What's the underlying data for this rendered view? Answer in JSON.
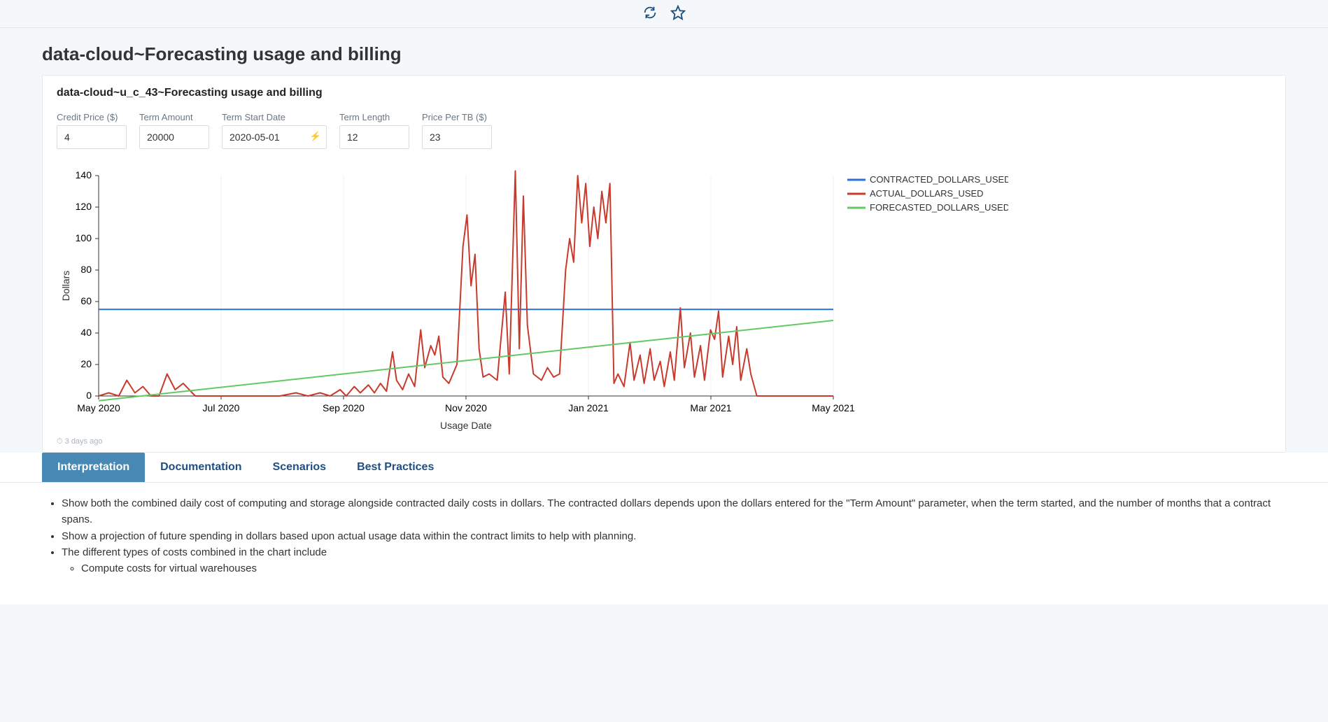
{
  "header": {
    "refresh_icon": "refresh",
    "star_icon": "star"
  },
  "page_title": "data-cloud~Forecasting usage and billing",
  "sub_title": "data-cloud~u_c_43~Forecasting usage and billing",
  "params": {
    "credit_price": {
      "label": "Credit Price ($)",
      "value": "4"
    },
    "term_amount": {
      "label": "Term Amount",
      "value": "20000"
    },
    "term_start_date": {
      "label": "Term Start Date",
      "value": "2020-05-01"
    },
    "term_length": {
      "label": "Term Length",
      "value": "12"
    },
    "price_per_tb": {
      "label": "Price Per TB ($)",
      "value": "23"
    }
  },
  "meta_text": "3 days ago",
  "tabs": {
    "items": [
      "Interpretation",
      "Documentation",
      "Scenarios",
      "Best Practices"
    ],
    "active_index": 0
  },
  "interpretation": {
    "bullets": [
      "Show both the combined daily cost of computing and storage alongside contracted daily costs in dollars. The contracted dollars depends upon the dollars entered for the \"Term Amount\" parameter, when the term started, and the number of months that a contract spans.",
      "Show a projection of future spending in dollars based upon actual usage data within the contract limits to help with planning.",
      "The different types of costs combined in the chart include"
    ],
    "sub_bullets": [
      "Compute costs for virtual warehouses"
    ]
  },
  "chart_data": {
    "type": "line",
    "title": "",
    "xlabel": "Usage Date",
    "ylabel": "Dollars",
    "ylim": [
      0,
      140
    ],
    "y_ticks": [
      0,
      20,
      40,
      60,
      80,
      100,
      120,
      140
    ],
    "x_tick_labels": [
      "May 2020",
      "Jul 2020",
      "Sep 2020",
      "Nov 2020",
      "Jan 2021",
      "Mar 2021",
      "May 2021"
    ],
    "x_range_days": [
      0,
      365
    ],
    "series": [
      {
        "name": "CONTRACTED_DOLLARS_USED",
        "color": "#2b6fd7",
        "type": "constant",
        "value": 55,
        "x_start": 0,
        "x_end": 365
      },
      {
        "name": "ACTUAL_DOLLARS_USED",
        "color": "#c83a2c",
        "type": "line",
        "data": [
          {
            "d": 0,
            "v": 0
          },
          {
            "d": 5,
            "v": 2
          },
          {
            "d": 10,
            "v": 0
          },
          {
            "d": 14,
            "v": 10
          },
          {
            "d": 18,
            "v": 2
          },
          {
            "d": 22,
            "v": 6
          },
          {
            "d": 26,
            "v": 0
          },
          {
            "d": 30,
            "v": 0
          },
          {
            "d": 34,
            "v": 14
          },
          {
            "d": 38,
            "v": 4
          },
          {
            "d": 42,
            "v": 8
          },
          {
            "d": 48,
            "v": 0
          },
          {
            "d": 60,
            "v": 0
          },
          {
            "d": 75,
            "v": 0
          },
          {
            "d": 90,
            "v": 0
          },
          {
            "d": 98,
            "v": 2
          },
          {
            "d": 104,
            "v": 0
          },
          {
            "d": 110,
            "v": 2
          },
          {
            "d": 115,
            "v": 0
          },
          {
            "d": 120,
            "v": 4
          },
          {
            "d": 123,
            "v": 0
          },
          {
            "d": 127,
            "v": 6
          },
          {
            "d": 130,
            "v": 2
          },
          {
            "d": 134,
            "v": 7
          },
          {
            "d": 137,
            "v": 2
          },
          {
            "d": 140,
            "v": 8
          },
          {
            "d": 143,
            "v": 3
          },
          {
            "d": 146,
            "v": 28
          },
          {
            "d": 148,
            "v": 10
          },
          {
            "d": 151,
            "v": 4
          },
          {
            "d": 154,
            "v": 14
          },
          {
            "d": 157,
            "v": 6
          },
          {
            "d": 160,
            "v": 42
          },
          {
            "d": 162,
            "v": 18
          },
          {
            "d": 165,
            "v": 32
          },
          {
            "d": 167,
            "v": 26
          },
          {
            "d": 169,
            "v": 38
          },
          {
            "d": 171,
            "v": 12
          },
          {
            "d": 174,
            "v": 8
          },
          {
            "d": 178,
            "v": 20
          },
          {
            "d": 181,
            "v": 95
          },
          {
            "d": 183,
            "v": 115
          },
          {
            "d": 185,
            "v": 70
          },
          {
            "d": 187,
            "v": 90
          },
          {
            "d": 189,
            "v": 30
          },
          {
            "d": 191,
            "v": 12
          },
          {
            "d": 194,
            "v": 14
          },
          {
            "d": 198,
            "v": 10
          },
          {
            "d": 202,
            "v": 66
          },
          {
            "d": 204,
            "v": 14
          },
          {
            "d": 207,
            "v": 143
          },
          {
            "d": 209,
            "v": 30
          },
          {
            "d": 211,
            "v": 127
          },
          {
            "d": 213,
            "v": 45
          },
          {
            "d": 216,
            "v": 14
          },
          {
            "d": 220,
            "v": 10
          },
          {
            "d": 223,
            "v": 18
          },
          {
            "d": 226,
            "v": 12
          },
          {
            "d": 229,
            "v": 14
          },
          {
            "d": 232,
            "v": 80
          },
          {
            "d": 234,
            "v": 100
          },
          {
            "d": 236,
            "v": 85
          },
          {
            "d": 238,
            "v": 140
          },
          {
            "d": 240,
            "v": 110
          },
          {
            "d": 242,
            "v": 135
          },
          {
            "d": 244,
            "v": 95
          },
          {
            "d": 246,
            "v": 120
          },
          {
            "d": 248,
            "v": 100
          },
          {
            "d": 250,
            "v": 130
          },
          {
            "d": 252,
            "v": 110
          },
          {
            "d": 254,
            "v": 135
          },
          {
            "d": 256,
            "v": 8
          },
          {
            "d": 258,
            "v": 14
          },
          {
            "d": 261,
            "v": 6
          },
          {
            "d": 264,
            "v": 34
          },
          {
            "d": 266,
            "v": 10
          },
          {
            "d": 269,
            "v": 26
          },
          {
            "d": 271,
            "v": 8
          },
          {
            "d": 274,
            "v": 30
          },
          {
            "d": 276,
            "v": 10
          },
          {
            "d": 279,
            "v": 22
          },
          {
            "d": 281,
            "v": 6
          },
          {
            "d": 284,
            "v": 28
          },
          {
            "d": 286,
            "v": 10
          },
          {
            "d": 289,
            "v": 56
          },
          {
            "d": 291,
            "v": 18
          },
          {
            "d": 294,
            "v": 40
          },
          {
            "d": 296,
            "v": 12
          },
          {
            "d": 299,
            "v": 32
          },
          {
            "d": 301,
            "v": 10
          },
          {
            "d": 304,
            "v": 42
          },
          {
            "d": 306,
            "v": 36
          },
          {
            "d": 308,
            "v": 54
          },
          {
            "d": 310,
            "v": 12
          },
          {
            "d": 313,
            "v": 38
          },
          {
            "d": 315,
            "v": 20
          },
          {
            "d": 317,
            "v": 44
          },
          {
            "d": 319,
            "v": 10
          },
          {
            "d": 322,
            "v": 30
          },
          {
            "d": 324,
            "v": 14
          },
          {
            "d": 327,
            "v": 0
          },
          {
            "d": 335,
            "v": 0
          },
          {
            "d": 345,
            "v": 0
          },
          {
            "d": 355,
            "v": 0
          },
          {
            "d": 365,
            "v": 0
          }
        ]
      },
      {
        "name": "FORECASTED_DOLLARS_USED",
        "color": "#63c864",
        "type": "linear",
        "start": {
          "d": 0,
          "v": -3
        },
        "end": {
          "d": 365,
          "v": 48
        }
      }
    ],
    "legend_position": "right"
  }
}
